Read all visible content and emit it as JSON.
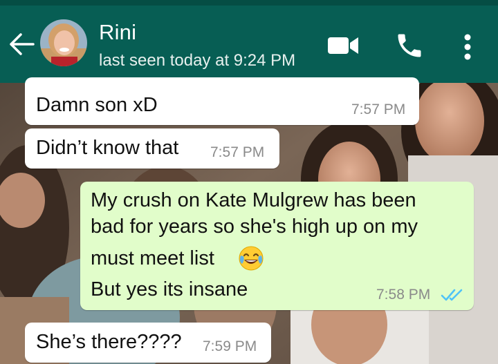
{
  "header": {
    "contact_name": "Rini",
    "last_seen": "last seen today at 9:24 PM",
    "back_icon": "arrow-left-icon",
    "video_icon": "video-camera-icon",
    "call_icon": "phone-icon",
    "menu_icon": "more-vertical-icon"
  },
  "colors": {
    "header_bg": "#075e54",
    "status_bar": "#054d44",
    "incoming_bubble": "#ffffff",
    "outgoing_bubble": "#e1fdca",
    "read_ticks": "#4fc3f7",
    "timestamp": "#8a8a8a"
  },
  "messages": [
    {
      "direction": "incoming",
      "text": "Damn son xD",
      "time": "7:57 PM"
    },
    {
      "direction": "incoming",
      "text": "Didn’t know that",
      "time": "7:57 PM"
    },
    {
      "direction": "outgoing",
      "lines": [
        "My crush on Kate Mulgrew has been",
        "bad for years so she's high up on my",
        "must meet list",
        "But yes its insane"
      ],
      "emoji": "face-with-tears-of-joy",
      "time": "7:58 PM",
      "status": "read"
    },
    {
      "direction": "incoming",
      "text": "She’s there????",
      "time": "7:59 PM"
    }
  ]
}
